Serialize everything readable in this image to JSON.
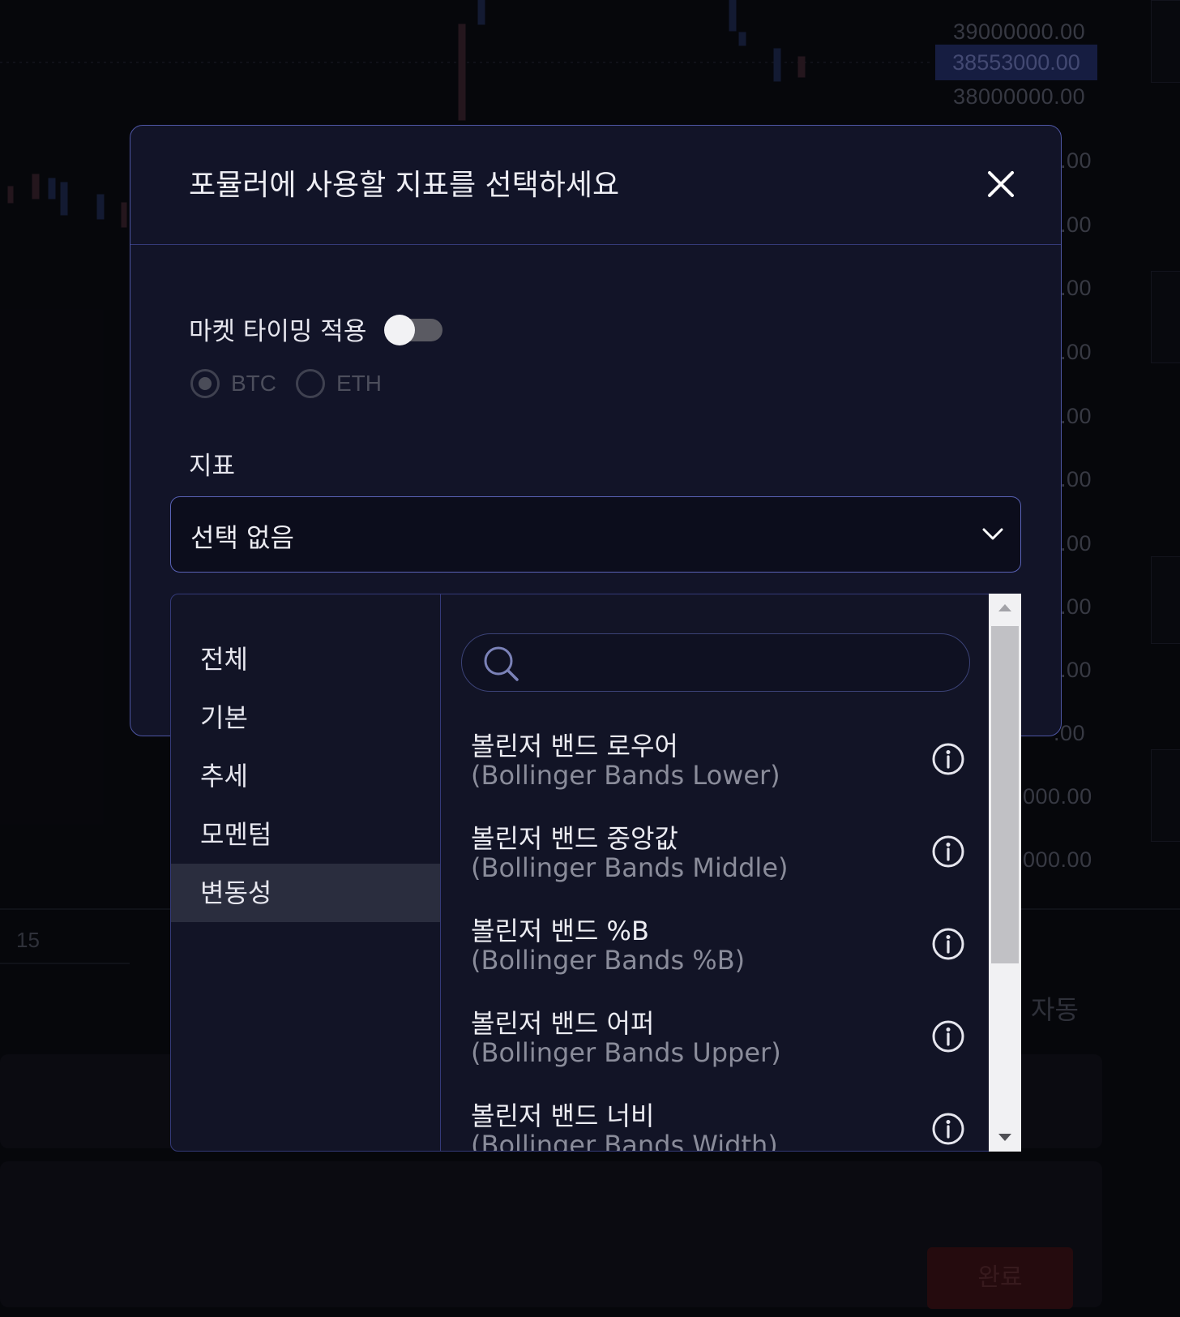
{
  "background": {
    "price_ticks": [
      "39000000.00",
      "38000000.00"
    ],
    "current_price": "38553000.00",
    "partial_ticks": [
      ".00",
      ".00",
      ".00",
      ".00",
      ".00",
      ".00",
      ".00",
      ".00",
      ".00",
      ".00",
      "000.00",
      "000.00"
    ],
    "time_label": "15",
    "auto_label": "자동",
    "done_label": "완료"
  },
  "modal": {
    "title": "포뮬러에 사용할 지표를 선택하세요",
    "market_timing_label": "마켓 타이밍 적용",
    "market_timing_enabled": false,
    "radios": [
      {
        "label": "BTC",
        "checked": true
      },
      {
        "label": "ETH",
        "checked": false
      }
    ],
    "indicator_label": "지표",
    "select_value": "선택 없음",
    "categories": [
      "전체",
      "기본",
      "추세",
      "모멘텀",
      "변동성"
    ],
    "active_category": "변동성",
    "search_placeholder": "",
    "indicators": [
      {
        "name": "볼린저 밴드 로우어",
        "english": "(Bollinger Bands Lower)"
      },
      {
        "name": "볼린저 밴드 중앙값",
        "english": "(Bollinger Bands Middle)"
      },
      {
        "name": "볼린저 밴드 %B",
        "english": "(Bollinger Bands %B)"
      },
      {
        "name": "볼린저 밴드 어퍼",
        "english": "(Bollinger Bands Upper)"
      },
      {
        "name": "볼린저 밴드 너비",
        "english": "(Bollinger Bands Width)"
      }
    ]
  },
  "colors": {
    "modal_border": "#4e56a4",
    "active_category_bg": "#2a2d3e",
    "modal_bg": "#121428"
  }
}
